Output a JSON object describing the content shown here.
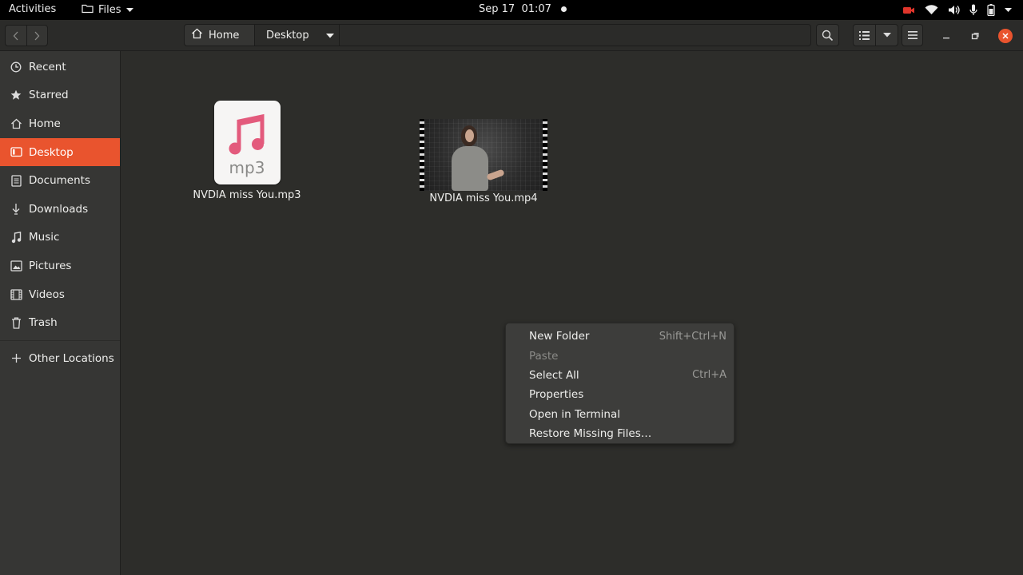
{
  "topbar": {
    "activities": "Activities",
    "app_name": "Files",
    "date": "Sep 17",
    "time": "01:07",
    "tray_icons": [
      "screen-record-icon",
      "wifi-icon",
      "volume-icon",
      "microphone-icon",
      "battery-icon",
      "system-menu-arrow-icon"
    ]
  },
  "headerbar": {
    "path": [
      {
        "label": "Home",
        "icon": "home-icon"
      },
      {
        "label": "Desktop",
        "icon": "dropdown-arrow-icon"
      }
    ]
  },
  "sidebar": {
    "items": [
      {
        "label": "Recent",
        "icon": "clock-icon"
      },
      {
        "label": "Starred",
        "icon": "star-icon"
      },
      {
        "label": "Home",
        "icon": "home-icon"
      },
      {
        "label": "Desktop",
        "icon": "desktop-icon",
        "active": true
      },
      {
        "label": "Documents",
        "icon": "document-icon"
      },
      {
        "label": "Downloads",
        "icon": "download-icon"
      },
      {
        "label": "Music",
        "icon": "music-icon"
      },
      {
        "label": "Pictures",
        "icon": "picture-icon"
      },
      {
        "label": "Videos",
        "icon": "video-icon"
      },
      {
        "label": "Trash",
        "icon": "trash-icon"
      }
    ],
    "other_locations": "Other Locations"
  },
  "files": [
    {
      "name": "NVDIA miss You.mp3",
      "type": "audio",
      "ext_label": "mp3"
    },
    {
      "name": "NVDIA miss You.mp4",
      "type": "video"
    }
  ],
  "context_menu": {
    "items": [
      {
        "label": "New Folder",
        "accel": "Shift+Ctrl+N",
        "enabled": true
      },
      {
        "label": "Paste",
        "accel": "",
        "enabled": false
      },
      {
        "label": "Select All",
        "accel": "Ctrl+A",
        "enabled": true
      },
      {
        "label": "Properties",
        "accel": "",
        "enabled": true
      },
      {
        "label": "Open in Terminal",
        "accel": "",
        "enabled": true
      },
      {
        "label": "Restore Missing Files…",
        "accel": "",
        "enabled": true
      }
    ]
  },
  "colors": {
    "accent": "#e9542e",
    "topbar_bg": "#000000",
    "sidebar_bg": "#363634",
    "main_bg": "#2d2d2a",
    "music_note": "#e35a7c"
  }
}
